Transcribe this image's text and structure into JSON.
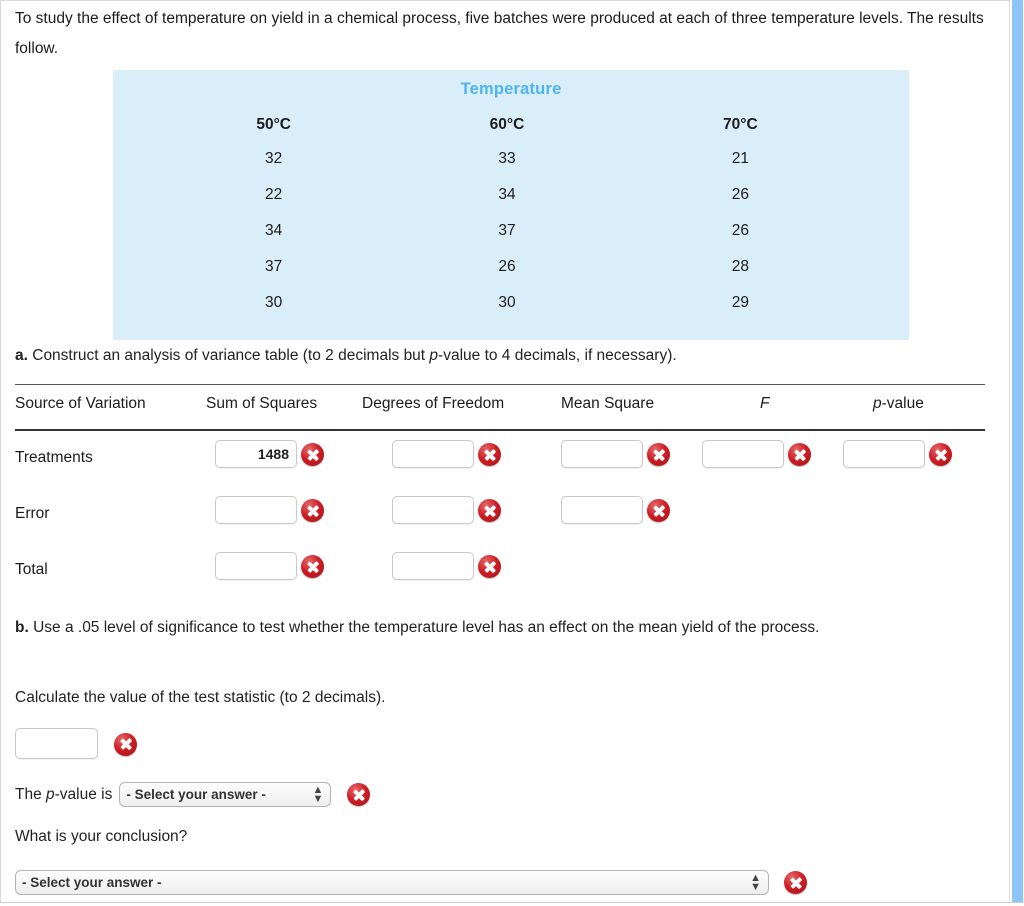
{
  "intro": {
    "text": "To study the effect of temperature on yield in a chemical process, five batches were produced at each of three temperature levels. The results follow."
  },
  "data_table": {
    "title": "Temperature",
    "columns": [
      "50°C",
      "60°C",
      "70°C"
    ],
    "rows": [
      [
        "32",
        "33",
        "21"
      ],
      [
        "22",
        "34",
        "26"
      ],
      [
        "34",
        "37",
        "26"
      ],
      [
        "37",
        "26",
        "28"
      ],
      [
        "30",
        "30",
        "29"
      ]
    ],
    "bg_color": "#daeefa",
    "title_color": "#4fb4f0"
  },
  "part_a": {
    "label": "a.",
    "text": " Construct an analysis of variance table (to 2 decimals but ",
    "italic": "p",
    "text2": "-value to 4 decimals, if necessary)."
  },
  "anova": {
    "headers": [
      "Source of Variation",
      "Sum of Squares",
      "Degrees of Freedom",
      "Mean Square",
      "F",
      "p-value"
    ],
    "rows": [
      {
        "label": "Treatments",
        "cells": [
          "1488",
          "",
          "",
          "",
          ""
        ],
        "status": [
          "error",
          "error",
          "error",
          "error",
          "error"
        ]
      },
      {
        "label": "Error",
        "cells": [
          "",
          "",
          ""
        ],
        "status": [
          "error",
          "error",
          "error"
        ]
      },
      {
        "label": "Total",
        "cells": [
          "",
          ""
        ],
        "status": [
          "error",
          "error"
        ]
      }
    ]
  },
  "part_b": {
    "label": "b.",
    "text": " Use a .05 level of significance to test whether the temperature level has an effect on the mean yield of the process."
  },
  "calc_statistic": {
    "prompt": "Calculate the value of the test statistic (to 2 decimals).",
    "value": "",
    "placeholder": ""
  },
  "pvalue_row": {
    "prefix": "The ",
    "italic": "p",
    "suffix": "-value is",
    "selected": "- Select your answer -"
  },
  "conclusion": {
    "question": "What is your conclusion?",
    "selected": "- Select your answer -"
  },
  "icons": {
    "error": "error-x-icon",
    "stepper": "updown-arrow-icon"
  },
  "colors": {
    "error_red": "#cf1f26",
    "table_bg": "#daeefa",
    "table_title": "#4fb4f0",
    "scrollbar": "#8dc5f8"
  }
}
